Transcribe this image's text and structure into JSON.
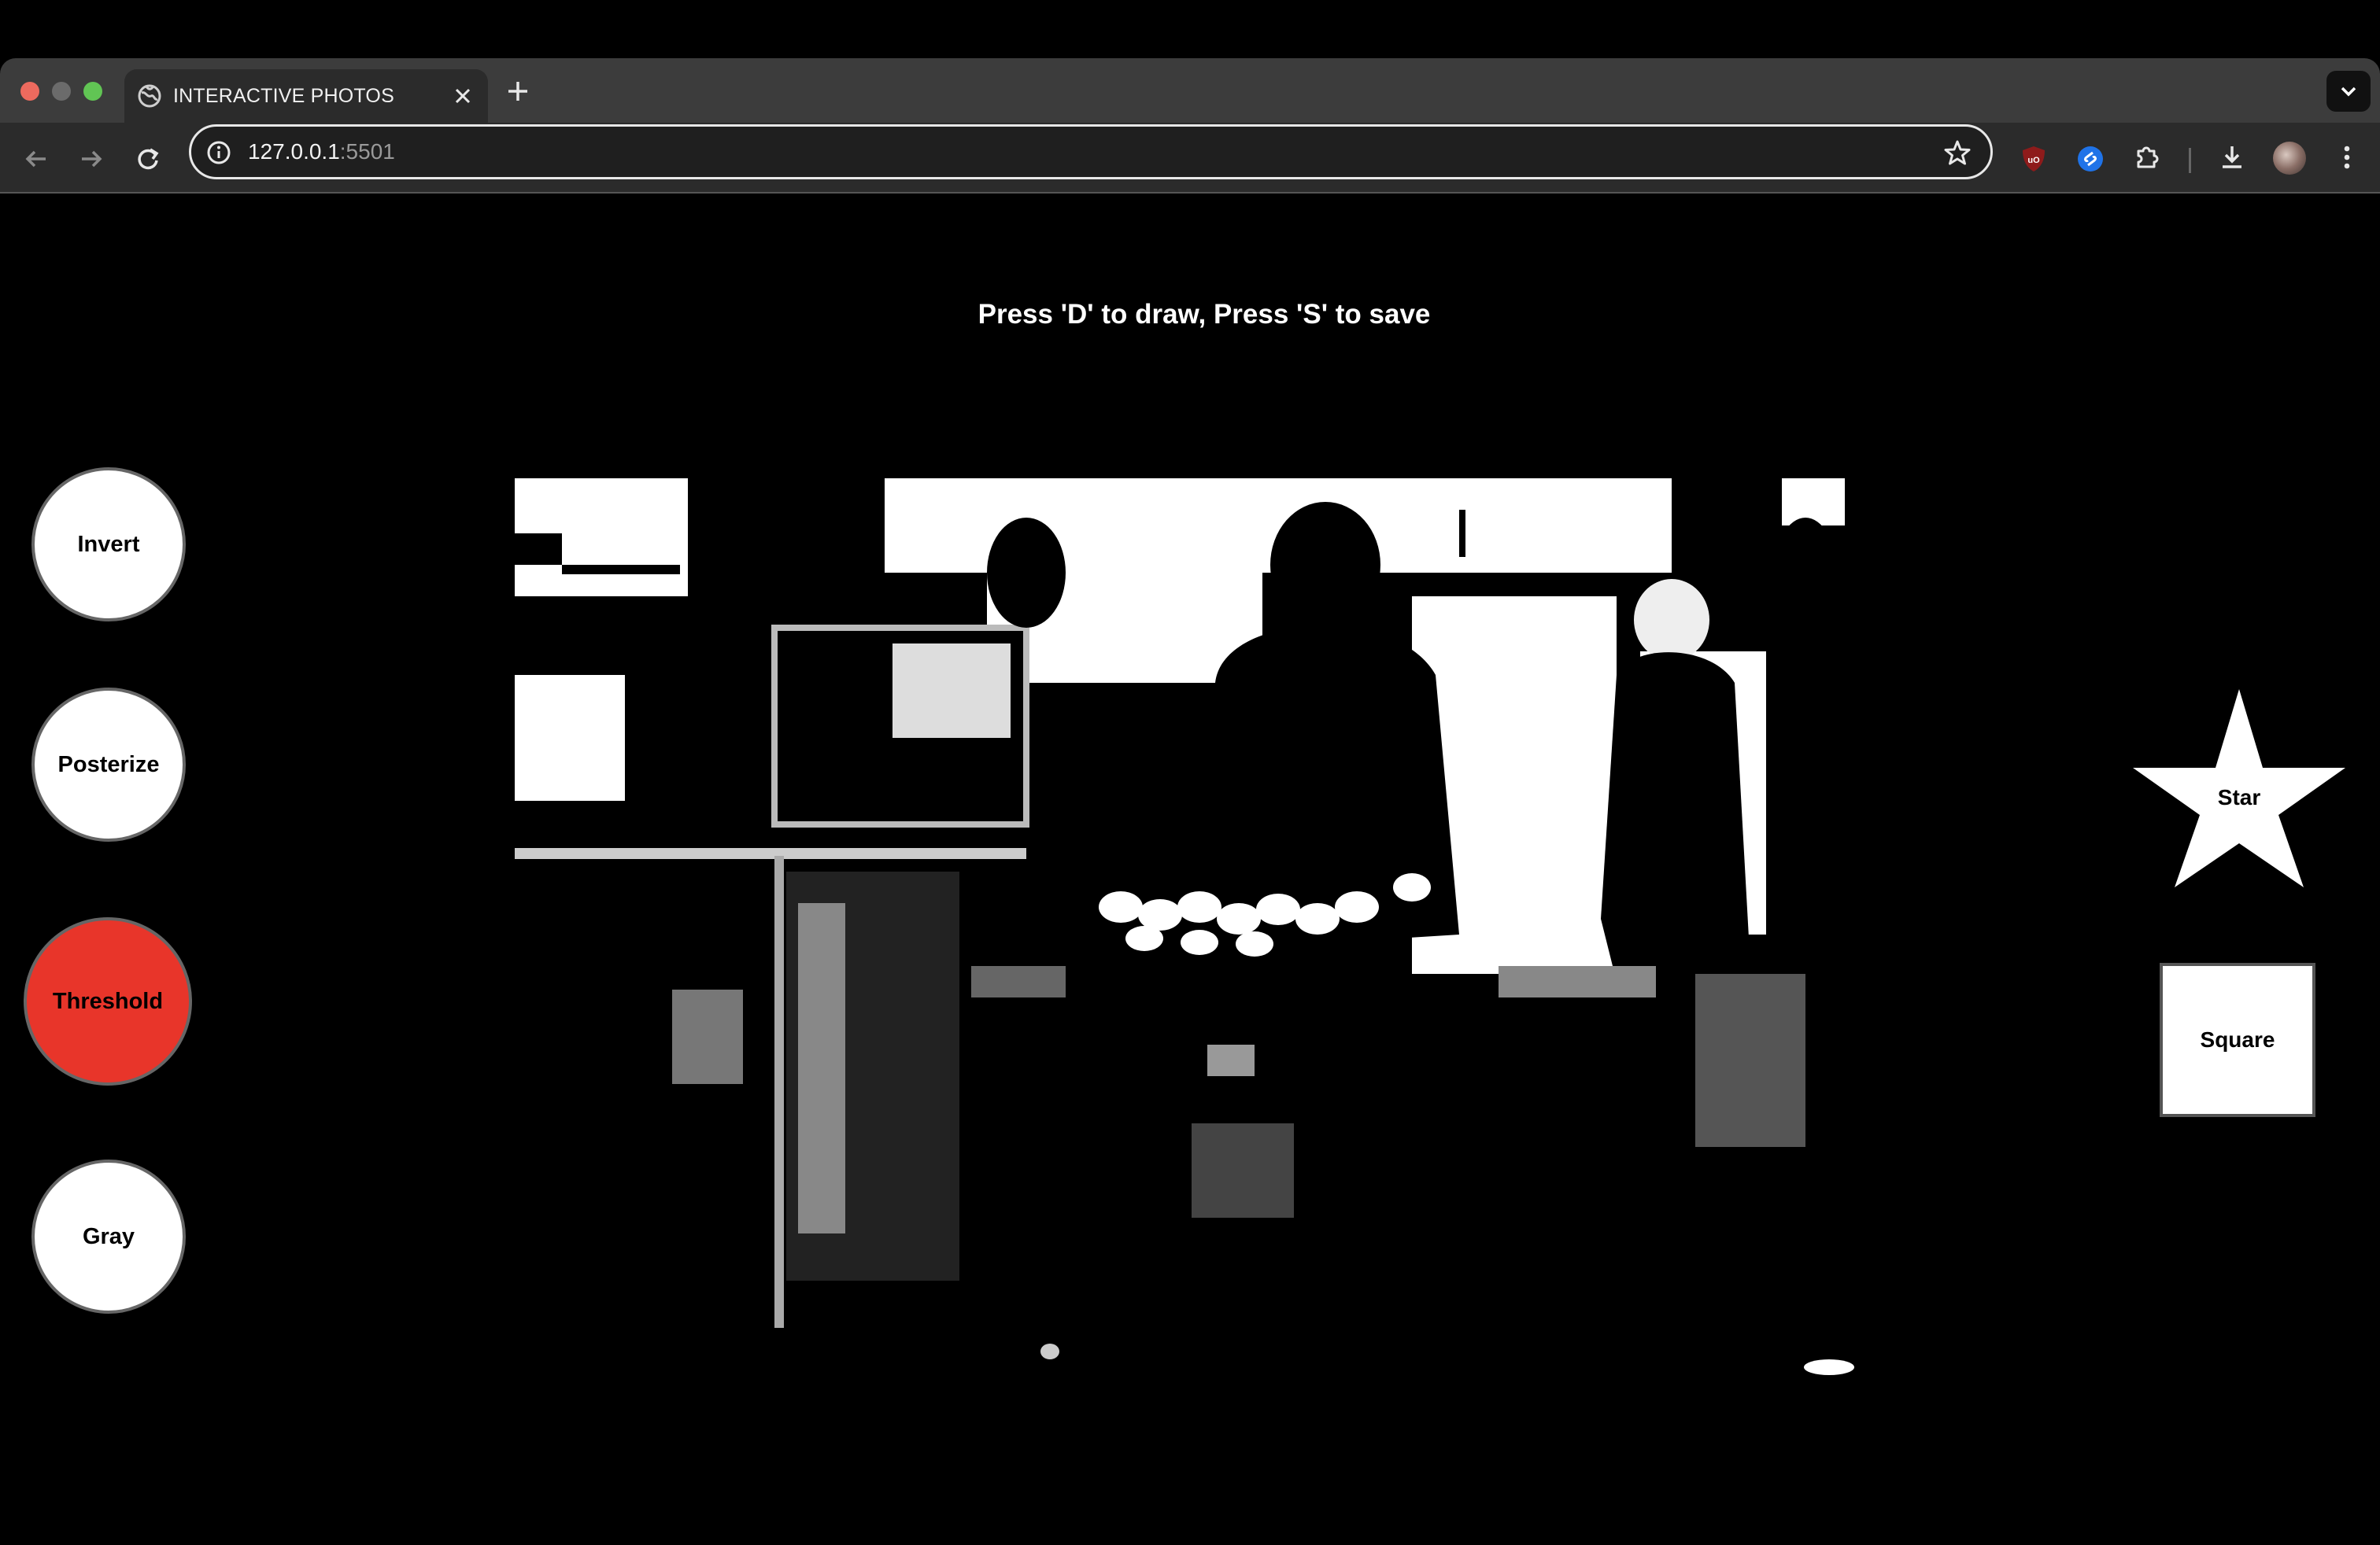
{
  "browser": {
    "tab_title": "INTERACTIVE PHOTOS",
    "url_host": "127.0.0.1",
    "url_port": ":5501"
  },
  "page": {
    "hint": "Press 'D' to draw, Press 'S' to save",
    "filters": [
      {
        "label": "Invert",
        "active": false
      },
      {
        "label": "Posterize",
        "active": false
      },
      {
        "label": "Threshold",
        "active": true
      },
      {
        "label": "Gray",
        "active": false
      }
    ],
    "active_color": "#e8352a",
    "shapes": {
      "star_label": "Star",
      "square_label": "Square"
    }
  }
}
